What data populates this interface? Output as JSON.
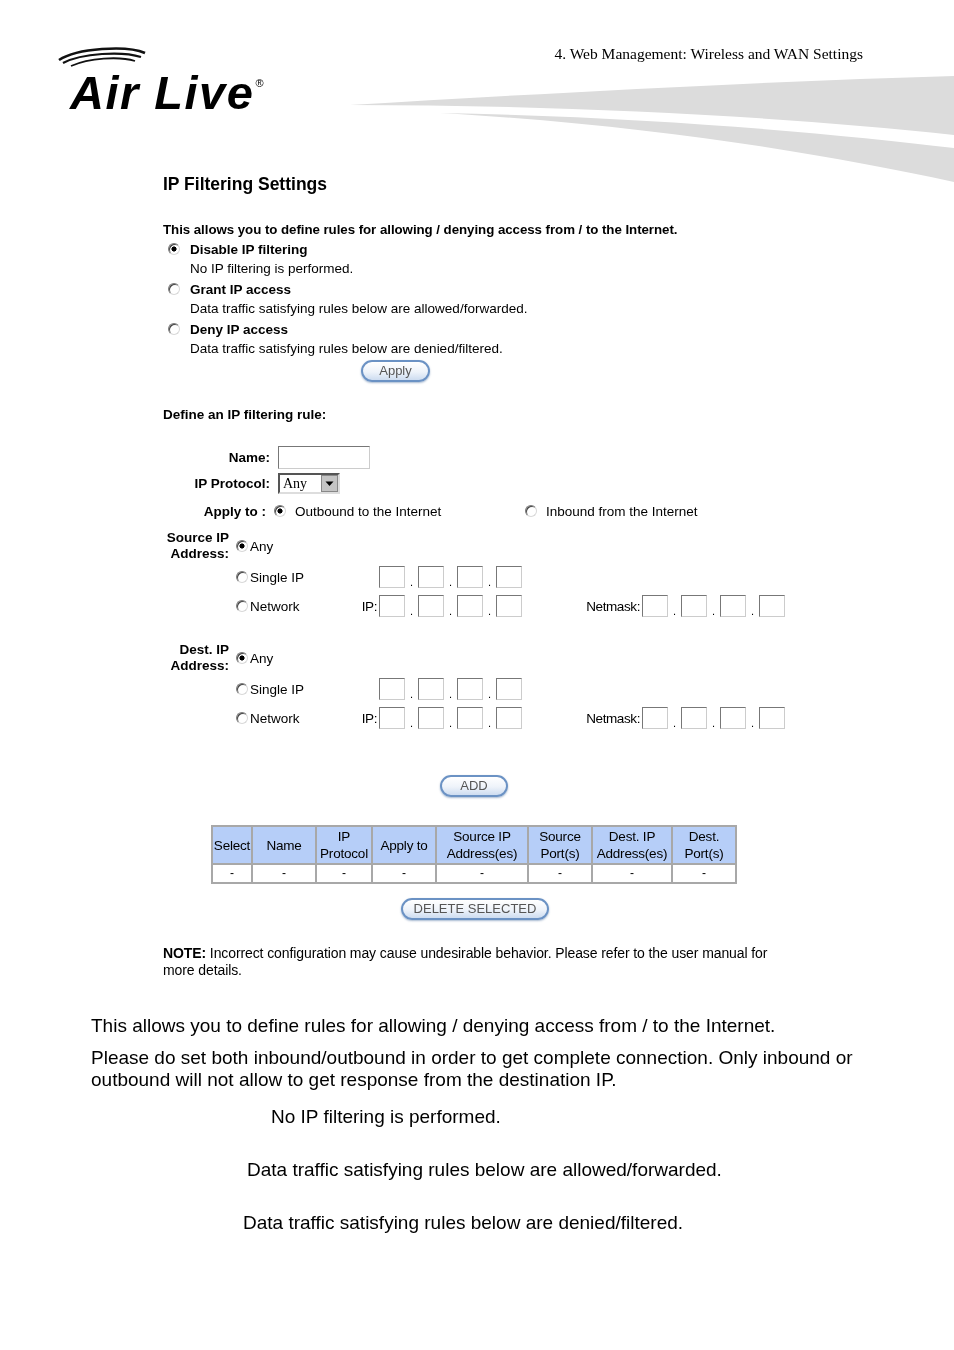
{
  "header": {
    "logo": "Air Live$^{®}$",
    "chapter": "4. Web Management: Wireless and WAN Settings"
  },
  "screenshot": {
    "title": "IP Filtering Settings",
    "intro": "This allows you to define rules for allowing / denying access from / to the Internet.",
    "modes": [
      {
        "label": "Disable IP filtering",
        "description": "No IP filtering is performed.",
        "selected": true
      },
      {
        "label": "Grant IP access",
        "description": "Data traffic satisfying rules below are allowed/forwarded.",
        "selected": false
      },
      {
        "label": "Deny IP access",
        "description": "Data traffic satisfying rules below are denied/filtered.",
        "selected": false
      }
    ],
    "apply_button": "Apply",
    "rule_heading": "Define an IP filtering rule:",
    "name_field": {
      "label": "Name:"
    },
    "protocol": {
      "label": "IP Protocol:",
      "value": "Any"
    },
    "apply_to": {
      "label": "Apply to :",
      "options": [
        {
          "label": "Outbound to the Internet",
          "selected": true
        },
        {
          "label": "Inbound from the Internet",
          "selected": false
        }
      ]
    },
    "address_groups": [
      {
        "label": "Source IP Address:",
        "options": [
          {
            "kind": "any",
            "label": "Any",
            "selected": true
          },
          {
            "kind": "single",
            "label": "Single IP",
            "selected": false,
            "address": {
              "separators": [
                ".",
                ".",
                "."
              ]
            }
          },
          {
            "kind": "network",
            "label": "Network",
            "selected": false,
            "ip": {
              "label": "IP:",
              "separators": [
                ".",
                ".",
                "."
              ]
            },
            "netmask": {
              "label": "Netmask:",
              "separators": [
                ".",
                ".",
                "."
              ]
            }
          }
        ]
      },
      {
        "label": "Dest. IP Address:",
        "options": [
          {
            "kind": "any",
            "label": "Any",
            "selected": true
          },
          {
            "kind": "single",
            "label": "Single IP",
            "selected": false,
            "address": {
              "separators": [
                ".",
                ".",
                "."
              ]
            }
          },
          {
            "kind": "network",
            "label": "Network",
            "selected": false,
            "ip": {
              "label": "IP:",
              "separators": [
                ".",
                ".",
                "."
              ]
            },
            "netmask": {
              "label": "Netmask:",
              "separators": [
                ".",
                ".",
                "."
              ]
            }
          }
        ]
      }
    ],
    "add_button": "ADD",
    "table": {
      "columns": [
        "Select",
        "Name",
        "IP Protocol",
        "Apply to",
        "Source IP Address(es)",
        "Source Port(s)",
        "Dest. IP Address(es)",
        "Dest. Port(s)"
      ],
      "rows": [
        [
          "-",
          "-",
          "-",
          "-",
          "-",
          "-",
          "-",
          "-"
        ]
      ]
    },
    "delete_button": "DELETE SELECTED",
    "note": "**NOTE:** Incorrect configuration may cause undesirable behavior. Please refer to the user manual for more details."
  },
  "body_text": [
    {
      "kind": "paragraph",
      "text": "This allows you to define rules for allowing / denying access from / to the Internet."
    },
    {
      "kind": "paragraph",
      "text": "Please do set both inbound/outbound in order to get complete connection. Only inbound or outbound will not allow to get response from the destination IP."
    },
    {
      "kind": "indented",
      "text": "No IP filtering is performed."
    },
    {
      "kind": "indented",
      "text": "Data traffic satisfying rules below are allowed/forwarded."
    },
    {
      "kind": "indented",
      "text": "Data traffic satisfying rules below are denied/filtered."
    }
  ]
}
